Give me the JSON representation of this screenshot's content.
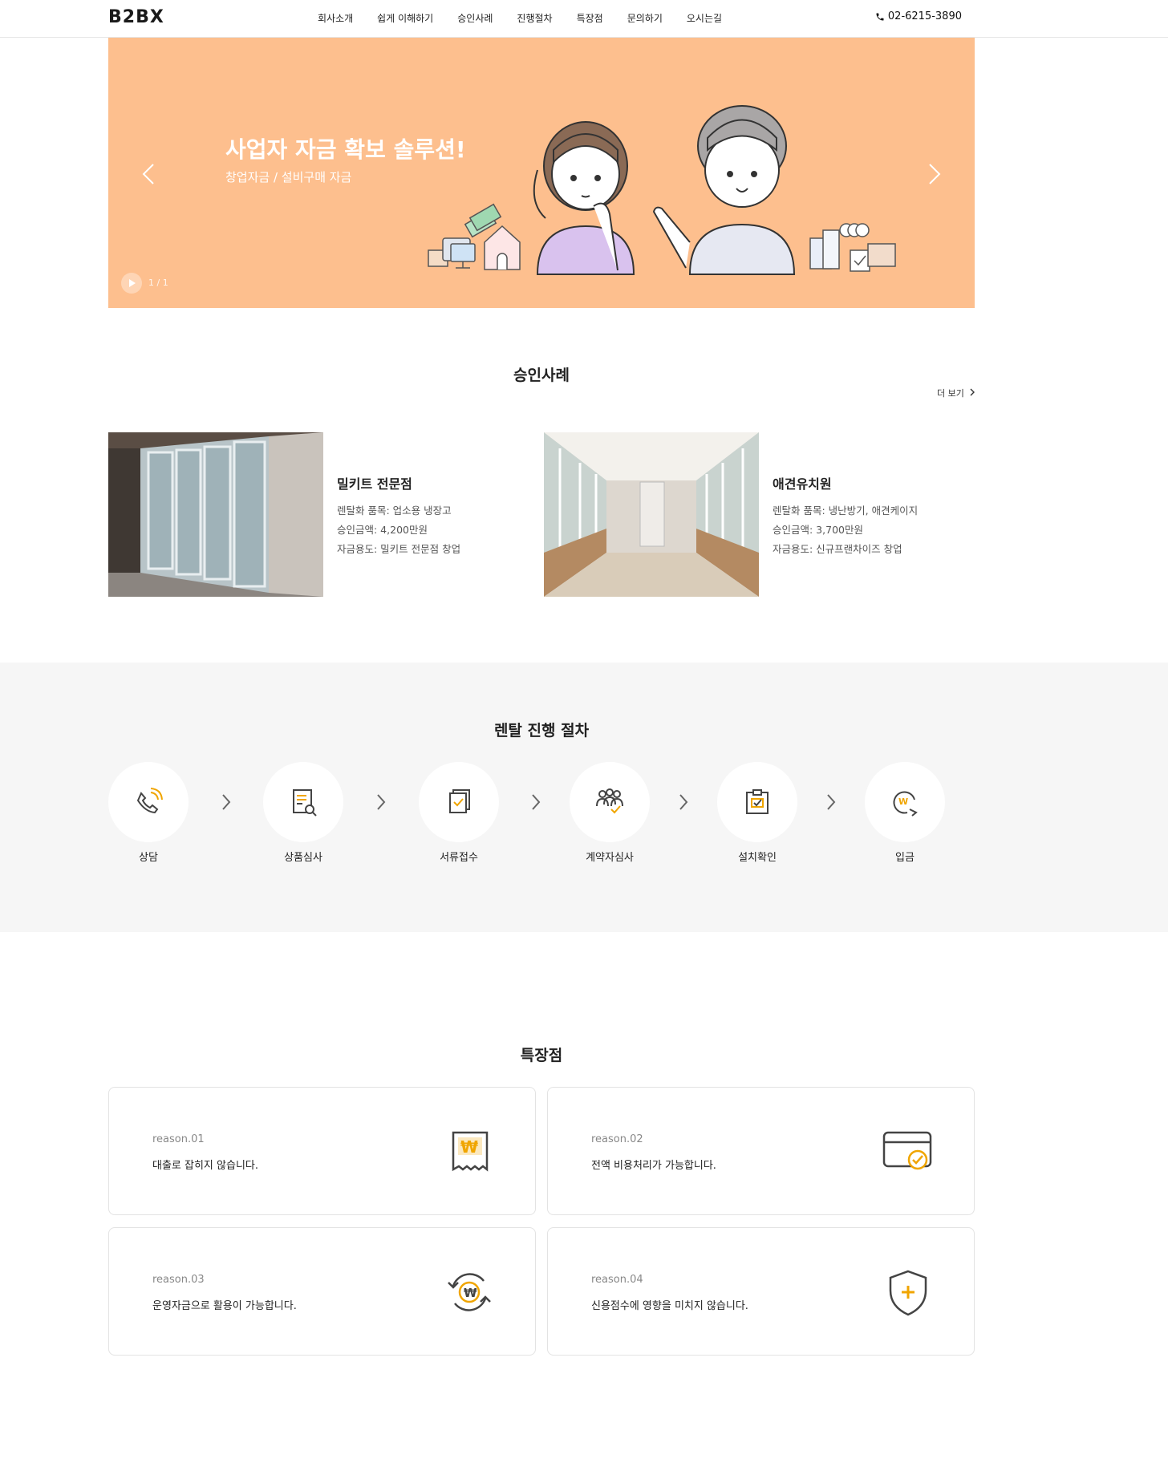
{
  "header": {
    "logo": "B2BX",
    "nav": [
      "회사소개",
      "쉽게 이해하기",
      "승인사례",
      "진행절차",
      "특장점",
      "문의하기",
      "오시는길"
    ],
    "phone": "02-6215-3890"
  },
  "banner": {
    "title": "사업자 자금 확보 솔루션!",
    "subtitle": "창업자금 / 설비구매 자금",
    "counter": "1 / 1",
    "background": "#fdbf8e"
  },
  "approvals": {
    "title": "승인사례",
    "more": "더 보기",
    "cases": [
      {
        "name": "밀키트 전문점",
        "item": "렌탈화 품목: 업소용 냉장고",
        "amount": "승인금액: 4,200만원",
        "purpose": "자금용도: 밀키트 전문점 창업"
      },
      {
        "name": "애견유치원",
        "item": "렌탈화 품목: 냉난방기, 애견케이지",
        "amount": "승인금액: 3,700만원",
        "purpose": "자금용도: 신규프랜차이즈 창업"
      }
    ]
  },
  "process": {
    "title": "렌탈 진행 절차",
    "steps": [
      "상담",
      "상품심사",
      "서류접수",
      "계약자심사",
      "설치확인",
      "입금"
    ],
    "accent": "#f0a500"
  },
  "features": {
    "title": "특장점",
    "reasons": [
      {
        "tag": "reason.01",
        "text": "대출로 잡히지 않습니다.",
        "icon": "won-receipt-icon"
      },
      {
        "tag": "reason.02",
        "text": "전액 비용처리가 가능합니다.",
        "icon": "card-check-icon"
      },
      {
        "tag": "reason.03",
        "text": "운영자금으로 활용이 가능합니다.",
        "icon": "won-cycle-icon"
      },
      {
        "tag": "reason.04",
        "text": "신용점수에 영향을 미치지 않습니다.",
        "icon": "shield-plus-icon"
      }
    ]
  }
}
